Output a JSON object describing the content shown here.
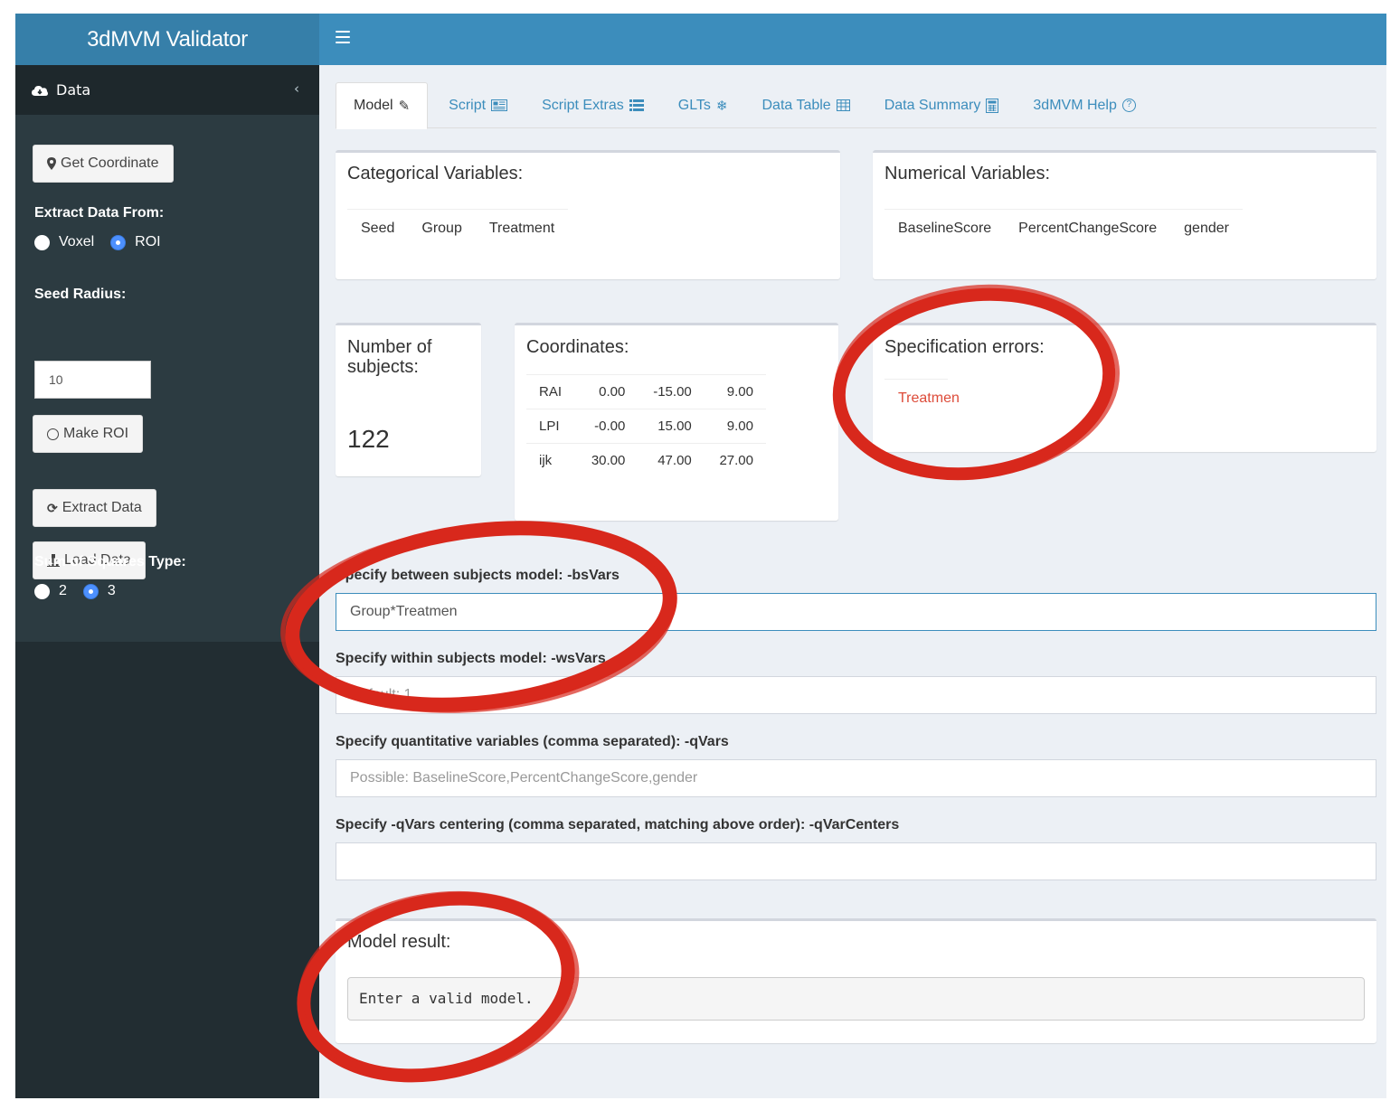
{
  "app": {
    "title": "3dMVM Validator"
  },
  "sidebar": {
    "section_label": "Data",
    "get_coordinate": "Get Coordinate",
    "extract_from_label": "Extract Data From:",
    "extract_options": [
      "Voxel",
      "ROI"
    ],
    "extract_selected": "ROI",
    "seed_radius_label": "Seed Radius:",
    "seed_radius_value": "10",
    "make_roi": "Make ROI",
    "extract_data": "Extract Data",
    "load_data": "Load Data",
    "ss_type_label": "Sum of Squares Type:",
    "ss_options": [
      "2",
      "3"
    ],
    "ss_selected": "3"
  },
  "tabs": [
    {
      "label": "Model",
      "icon": "edit-icon",
      "active": true
    },
    {
      "label": "Script",
      "icon": "newspaper-icon"
    },
    {
      "label": "Script Extras",
      "icon": "list-icon"
    },
    {
      "label": "GLTs",
      "icon": "snowflake-icon"
    },
    {
      "label": "Data Table",
      "icon": "table-icon"
    },
    {
      "label": "Data Summary",
      "icon": "calculator-icon"
    },
    {
      "label": "3dMVM Help",
      "icon": "question-circle-icon"
    }
  ],
  "categorical": {
    "title": "Categorical Variables:",
    "vars": [
      "Seed",
      "Group",
      "Treatment"
    ]
  },
  "numerical": {
    "title": "Numerical Variables:",
    "vars": [
      "BaselineScore",
      "PercentChangeScore",
      "gender"
    ]
  },
  "subjects": {
    "title": "Number of subjects:",
    "count": "122"
  },
  "coordinates": {
    "title": "Coordinates:",
    "rows": [
      [
        "RAI",
        "0.00",
        "-15.00",
        "9.00"
      ],
      [
        "LPI",
        "-0.00",
        "15.00",
        "9.00"
      ],
      [
        "ijk",
        "30.00",
        "47.00",
        "27.00"
      ]
    ]
  },
  "spec_errors": {
    "title": "Specification errors:",
    "errors": [
      "Treatmen"
    ],
    "color": "#dd4b39"
  },
  "form": {
    "bsvars_label": "Specify between subjects model: -bsVars",
    "bsvars_value": "Group*Treatmen",
    "wsvars_label": "Specify within subjects model: -wsVars",
    "wsvars_placeholder": "Default: 1",
    "qvars_label": "Specify quantitative variables (comma separated): -qVars",
    "qvars_placeholder": "Possible: BaselineScore,PercentChangeScore,gender",
    "qvarcenters_label": "Specify -qVars centering (comma separated, matching above order): -qVarCenters",
    "qvarcenters_value": ""
  },
  "model_result": {
    "title": "Model result:",
    "output": "Enter a valid model."
  },
  "colors": {
    "header": "#3c8dbc",
    "logo": "#367fa9",
    "sidebar": "#222d32",
    "annotation": "#d8281c"
  }
}
